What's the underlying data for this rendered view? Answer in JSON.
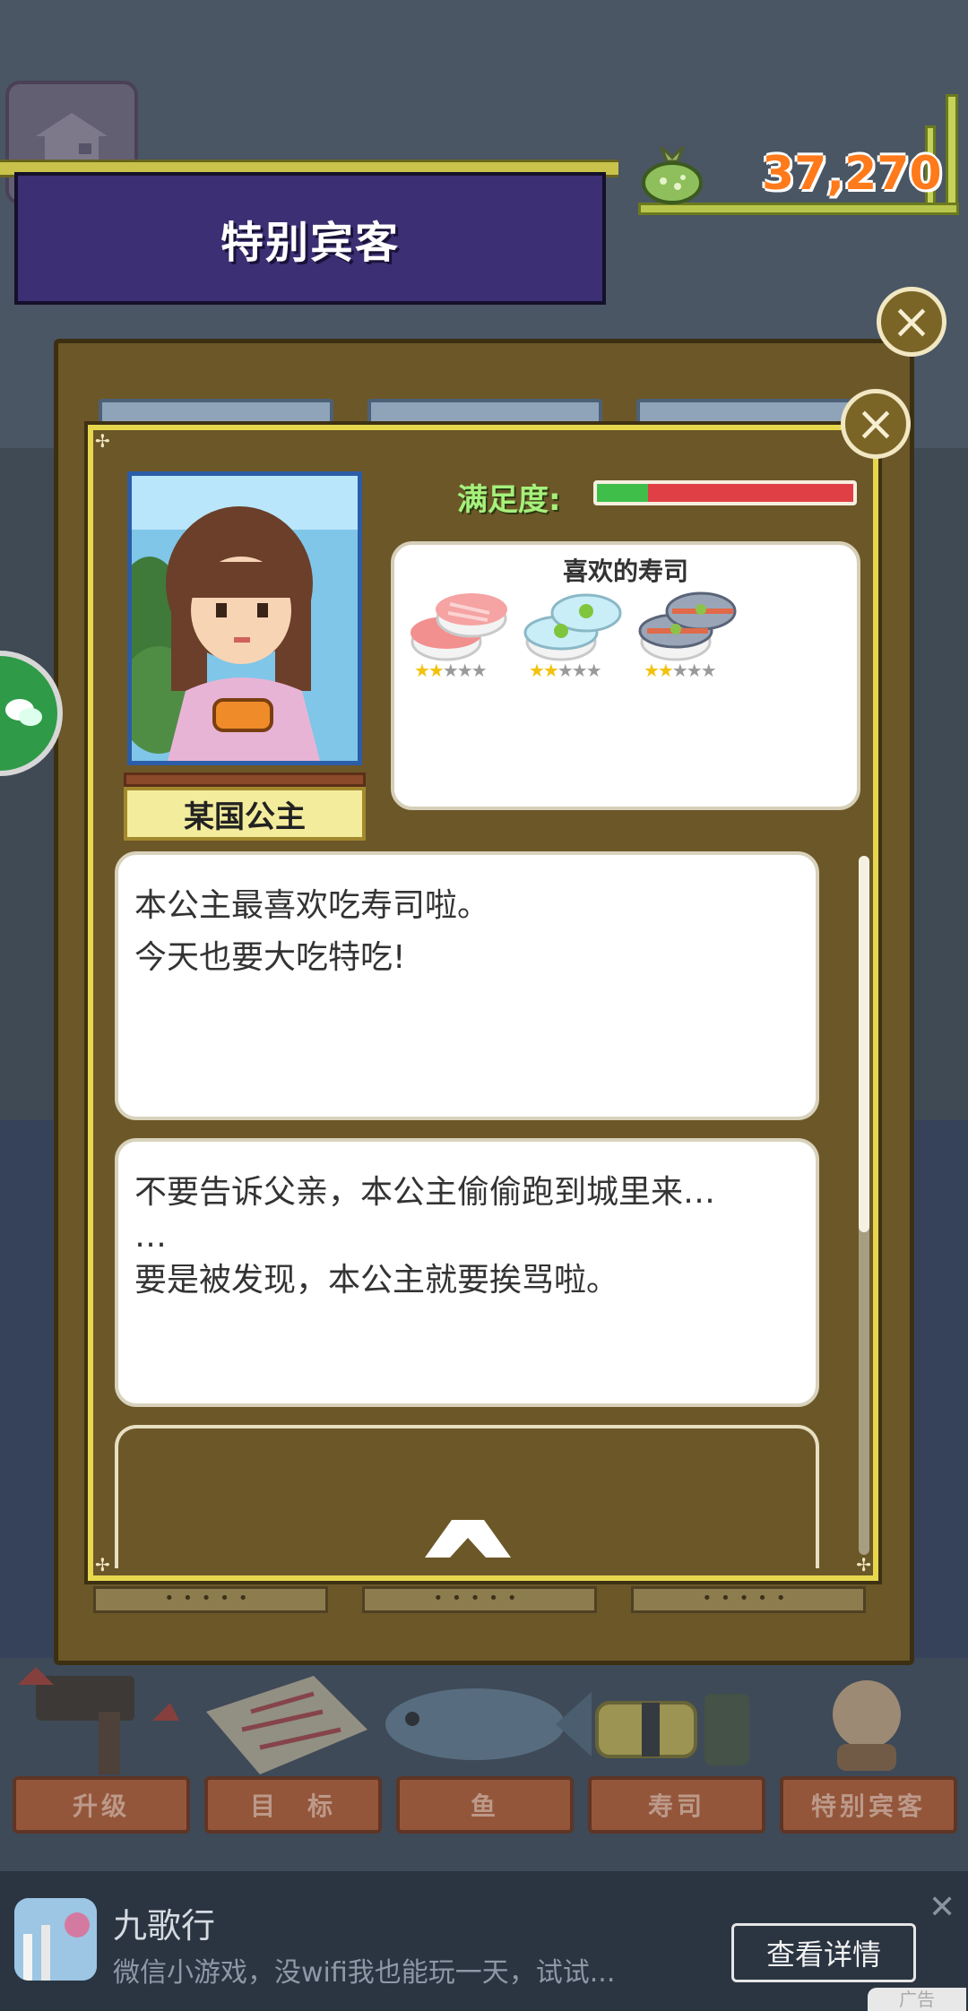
{
  "banner": {
    "title": "特别宾客"
  },
  "wallet": {
    "amount": "37,270"
  },
  "guest": {
    "name": "某国公主",
    "satisfaction_label": "满足度:",
    "satisfaction_level": 0.2
  },
  "favorites": {
    "title": "喜欢的寿司",
    "items": [
      {
        "name": "sushi-1",
        "stars": 2,
        "max_stars": 5
      },
      {
        "name": "sushi-2",
        "stars": 2,
        "max_stars": 5
      },
      {
        "name": "sushi-3",
        "stars": 2,
        "max_stars": 5
      }
    ]
  },
  "dialogs": [
    {
      "lines": [
        "本公主最喜欢吃寿司啦。",
        "今天也要大吃特吃!"
      ]
    },
    {
      "lines": [
        "不要告诉父亲，本公主偷偷跑到城里来…",
        "…",
        "要是被发现，本公主就要挨骂啦。"
      ]
    }
  ],
  "menu": {
    "upgrade": "升级",
    "goal": "目　标",
    "fish": "鱼",
    "sushi": "寿司",
    "special_guest": "特别宾客"
  },
  "ad": {
    "title": "九歌行",
    "description": "微信小游戏，没wifi我也能玩一天，试试...",
    "cta": "查看详情",
    "tag": "广告"
  },
  "colors": {
    "banner": "#3c2f74",
    "panel": "#6c5728",
    "panel_border": "#e7d74e",
    "money": "#ff7a1a",
    "satisfaction_good": "#3fbf4a",
    "satisfaction_bad": "#e03f46"
  }
}
